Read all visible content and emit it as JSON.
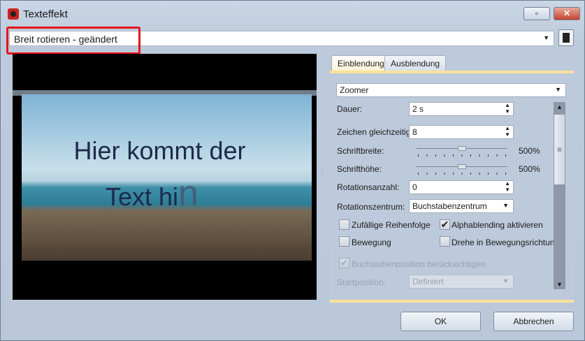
{
  "window": {
    "title": "Texteffekt",
    "minimize_icon": "restore-icon",
    "close_icon": "close-icon"
  },
  "preset": {
    "value": "Breit rotieren - geändert",
    "save_icon": "floppy-disk-icon"
  },
  "preview": {
    "line1": "Hier kommt der",
    "line2": "Text hi",
    "line2_anim": "n"
  },
  "tabs": [
    {
      "label": "Einblendung",
      "active": true
    },
    {
      "label": "Ausblendung",
      "active": false
    }
  ],
  "effect": {
    "value": "Zoomer"
  },
  "fields": {
    "dauer": {
      "label": "Dauer:",
      "value": "2 s"
    },
    "zeichen": {
      "label": "Zeichen gleichzeitig:",
      "value": "8"
    },
    "schriftbreite": {
      "label": "Schriftbreite:",
      "value": "500%",
      "slider_fraction": 0.5
    },
    "schrifthoehe": {
      "label": "Schrifthöhe:",
      "value": "500%",
      "slider_fraction": 0.5
    },
    "rotationsanzahl": {
      "label": "Rotationsanzahl:",
      "value": "0"
    },
    "rotationszentrum": {
      "label": "Rotationszentrum:",
      "value": "Buchstabenzentrum"
    },
    "startposition": {
      "label": "Startposition:",
      "value": "Definiert"
    }
  },
  "checkboxes": {
    "zufaellig": {
      "label": "Zufällige Reihenfolge",
      "checked": false
    },
    "alpha": {
      "label": "Alphablending aktivieren",
      "checked": true
    },
    "bewegung": {
      "label": "Bewegung",
      "checked": false
    },
    "drehe": {
      "label": "Drehe in Bewegungsrichtung",
      "checked": false
    },
    "buchstabenpos": {
      "label": "Buchstabenposition berücksichtigen",
      "checked": true,
      "disabled": true
    }
  },
  "buttons": {
    "ok": "OK",
    "cancel": "Abbrechen"
  }
}
